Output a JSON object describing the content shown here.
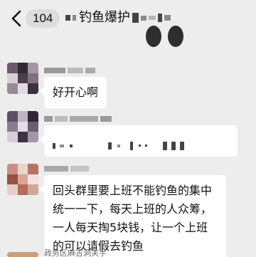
{
  "header": {
    "back_icon": "chevron-left-icon",
    "unread_count": "104",
    "title": "钓鱼爆护"
  },
  "messages": [
    {
      "text": "好开心啊"
    },
    {
      "text": ""
    },
    {
      "text": "回头群里要上班不能钓鱼的集中统一一下，每天上班的人众筹，一人每天掏5块钱，让一个上班的可以请假去钓鱼"
    }
  ],
  "next_sender": "政务区麻吉洞关手"
}
